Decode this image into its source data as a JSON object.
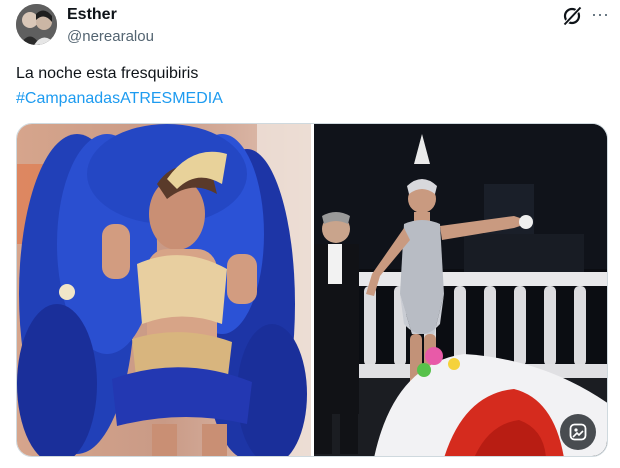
{
  "author": {
    "display_name": "Esther",
    "handle": "@nerearalou",
    "avatar_icon": "avatar-photo"
  },
  "header_actions": {
    "grok_icon": "grok-icon",
    "more_icon": "more-options-icon",
    "more_glyph": "···"
  },
  "tweet": {
    "text": "La noche esta fresquibiris",
    "hashtag": "#CampanadasATRESMEDIA"
  },
  "media": {
    "count": 2,
    "photos": [
      {
        "subject": "performer in blue feather showgirl costume"
      },
      {
        "subject": "woman in silver fringed dress with feather headpiece and man in tuxedo"
      }
    ],
    "alt_button_icon": "image-description-icon"
  },
  "colors": {
    "link": "#1d9bf0",
    "text": "#0f1419",
    "secondary": "#536471"
  }
}
